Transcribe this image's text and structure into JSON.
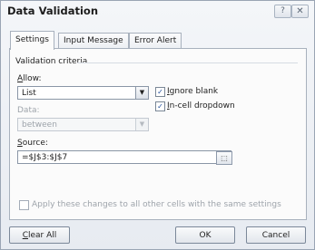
{
  "dialog": {
    "title": "Data Validation",
    "help_glyph": "?",
    "close_glyph": "✕"
  },
  "tabs": [
    {
      "label": "Settings",
      "active": true
    },
    {
      "label": "Input Message",
      "active": false
    },
    {
      "label": "Error Alert",
      "active": false
    }
  ],
  "settings": {
    "group_label": "Validation criteria",
    "allow": {
      "label_key": "A",
      "label_rest": "llow:",
      "value": "List"
    },
    "data": {
      "label": "Data:",
      "value": "between",
      "enabled": false
    },
    "ignore_blank": {
      "label_key": "I",
      "label_pre": "",
      "label_rest": "gnore blank",
      "checked": true
    },
    "in_cell_dropdown": {
      "label_key": "I",
      "label_rest": "n-cell dropdown",
      "checked": true
    },
    "source": {
      "label_key": "S",
      "label_rest": "ource:",
      "value": "=$J$3:$J$7"
    },
    "apply_all": {
      "label": "Apply these changes to all other cells with the same settings",
      "checked": false
    }
  },
  "buttons": {
    "clear_key": "C",
    "clear_rest": "lear All",
    "ok": "OK",
    "cancel": "Cancel"
  },
  "icons": {
    "dropdown": "▼",
    "checkmark": "✓",
    "range_picker": "⬚"
  }
}
